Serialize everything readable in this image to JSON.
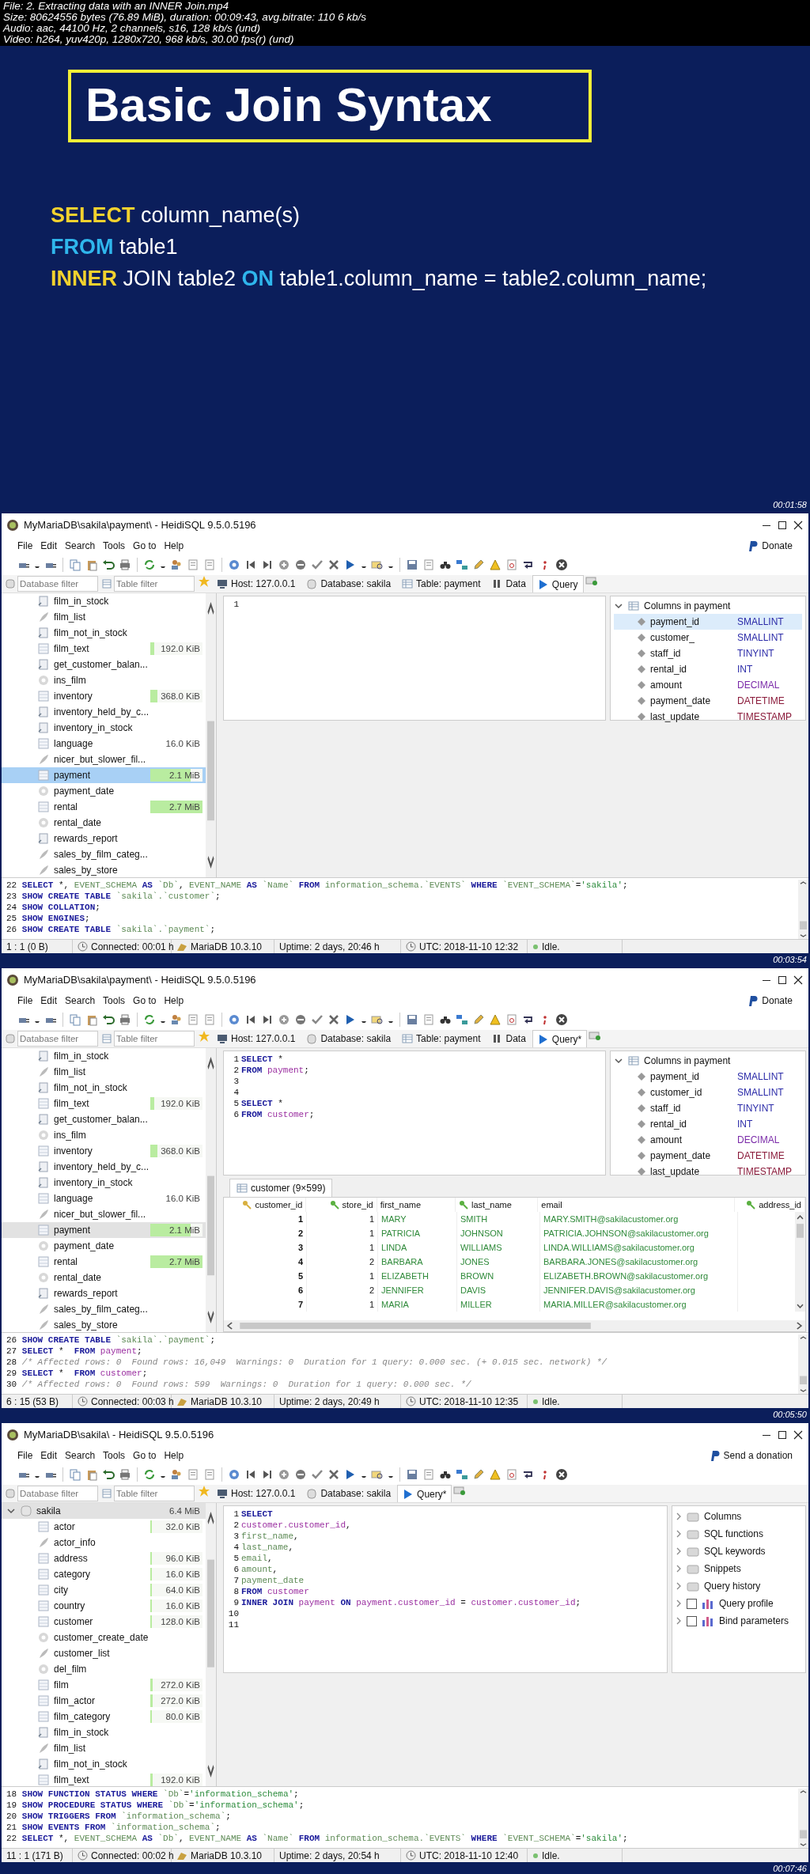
{
  "file_info": [
    "File: 2. Extracting data with an INNER Join.mp4",
    "Size: 80624556 bytes (76.89 MiB), duration: 00:09:43, avg.bitrate: 110 6 kb/s",
    "Audio: aac, 44100 Hz, 2 channels, s16, 128 kb/s (und)",
    "Video: h264, yuv420p, 1280x720, 968 kb/s, 30.00 fps(r) (und)"
  ],
  "slide": {
    "title": "Basic Join Syntax",
    "lines": [
      [
        {
          "text": "SELECT",
          "kind": "kw1"
        },
        {
          "text": " column_name(s)",
          "kind": "plain"
        }
      ],
      [
        {
          "text": "FROM",
          "kind": "kw2"
        },
        {
          "text": " table1",
          "kind": "plain"
        }
      ],
      [
        {
          "text": "INNER",
          "kind": "kw1"
        },
        {
          "text": " JOIN table2 ",
          "kind": "plain"
        },
        {
          "text": "ON",
          "kind": "kw2"
        },
        {
          "text": " table1.column_name = table2.column_name;",
          "kind": "plain"
        }
      ]
    ],
    "timestamp": "00:01:58"
  },
  "frames": [
    {
      "window_title": "MyMariaDB\\sakila\\payment\\ - HeidiSQL 9.5.0.5196",
      "menu": [
        "File",
        "Edit",
        "Search",
        "Tools",
        "Go to",
        "Help"
      ],
      "donate": "Donate",
      "filters": [
        {
          "placeholder": "Database filter"
        },
        {
          "placeholder": "Table filter"
        }
      ],
      "tabs": [
        {
          "label": "Host: 127.0.0.1",
          "kind": "host",
          "selected": false
        },
        {
          "label": "Database: sakila",
          "kind": "database",
          "selected": false
        },
        {
          "label": "Table: payment",
          "kind": "table",
          "selected": false
        },
        {
          "label": "Data",
          "kind": "data",
          "selected": false
        },
        {
          "label": "Query",
          "kind": "query",
          "selected": true
        }
      ],
      "tree_focused": true,
      "tree": [
        {
          "name": "film_in_stock",
          "kind": "procedure",
          "selected": false
        },
        {
          "name": "film_list",
          "kind": "view",
          "selected": false
        },
        {
          "name": "film_not_in_stock",
          "kind": "procedure",
          "selected": false
        },
        {
          "name": "film_text",
          "kind": "table",
          "size": "192.0 KiB",
          "level": 0.07,
          "selected": false
        },
        {
          "name": "get_customer_balan...",
          "kind": "function",
          "selected": false
        },
        {
          "name": "ins_film",
          "kind": "trigger",
          "selected": false
        },
        {
          "name": "inventory",
          "kind": "table",
          "size": "368.0 KiB",
          "level": 0.14,
          "selected": false
        },
        {
          "name": "inventory_held_by_c...",
          "kind": "function",
          "selected": false
        },
        {
          "name": "inventory_in_stock",
          "kind": "function",
          "selected": false
        },
        {
          "name": "language",
          "kind": "table",
          "size": "16.0 KiB",
          "selected": false
        },
        {
          "name": "nicer_but_slower_fil...",
          "kind": "view",
          "selected": false
        },
        {
          "name": "payment",
          "kind": "table",
          "size": "2.1 MiB",
          "level": 0.78,
          "selected": true
        },
        {
          "name": "payment_date",
          "kind": "trigger",
          "selected": false
        },
        {
          "name": "rental",
          "kind": "table",
          "size": "2.7 MiB",
          "level": 1,
          "selected": false
        },
        {
          "name": "rental_date",
          "kind": "trigger",
          "selected": false
        },
        {
          "name": "rewards_report",
          "kind": "procedure",
          "selected": false
        },
        {
          "name": "sales_by_film_categ...",
          "kind": "view",
          "selected": false
        },
        {
          "name": "sales_by_store",
          "kind": "view",
          "selected": false
        }
      ],
      "editor": [
        {
          "no": "1"
        }
      ],
      "side_panel": {
        "kind": "columns",
        "title": "Columns in payment",
        "expanded": true,
        "items": [
          {
            "name": "payment_id",
            "type": "SMALLINT",
            "color": "#2a2aa8",
            "selected": true
          },
          {
            "name": "customer_",
            "type": "SMALLINT",
            "color": "#2a2aa8",
            "selected": false
          },
          {
            "name": "staff_id",
            "type": "TINYINT",
            "color": "#2a2aa8",
            "selected": false
          },
          {
            "name": "rental_id",
            "type": "INT",
            "color": "#2a2aa8",
            "selected": false
          },
          {
            "name": "amount",
            "type": "DECIMAL",
            "color": "#7a2aa8",
            "selected": false
          },
          {
            "name": "payment_date",
            "type": "DATETIME",
            "color": "#8a1a3a",
            "selected": false
          },
          {
            "name": "last_update",
            "type": "TIMESTAMP",
            "color": "#8a1a3a",
            "selected": false
          }
        ]
      },
      "log": [
        {
          "no": "22",
          "tokens": [
            {
              "text": "SELECT",
              "kind": "kw"
            },
            {
              "text": " *, ",
              "kind": "txt"
            },
            {
              "text": "EVENT_SCHEMA",
              "kind": "col"
            },
            {
              "text": " AS",
              "kind": "kw"
            },
            {
              "text": " `Db`",
              "kind": "col"
            },
            {
              "text": ", ",
              "kind": "txt"
            },
            {
              "text": "EVENT_NAME",
              "kind": "col"
            },
            {
              "text": " AS",
              "kind": "kw"
            },
            {
              "text": " `Name`",
              "kind": "col"
            },
            {
              "text": " FROM",
              "kind": "kw"
            },
            {
              "text": " information_schema.`EVENTS`",
              "kind": "col"
            },
            {
              "text": " WHERE",
              "kind": "kw"
            },
            {
              "text": " `EVENT_SCHEMA`",
              "kind": "col"
            },
            {
              "text": "=",
              "kind": "txt"
            },
            {
              "text": "'sakila'",
              "kind": "str"
            },
            {
              "text": ";",
              "kind": "txt"
            }
          ]
        },
        {
          "no": "23",
          "tokens": [
            {
              "text": "SHOW CREATE TABLE",
              "kind": "kw"
            },
            {
              "text": " `sakila`.`customer`",
              "kind": "col"
            },
            {
              "text": ";",
              "kind": "txt"
            }
          ]
        },
        {
          "no": "24",
          "tokens": [
            {
              "text": "SHOW COLLATION",
              "kind": "kw"
            },
            {
              "text": ";",
              "kind": "txt"
            }
          ]
        },
        {
          "no": "25",
          "tokens": [
            {
              "text": "SHOW ENGINES",
              "kind": "kw"
            },
            {
              "text": ";",
              "kind": "txt"
            }
          ]
        },
        {
          "no": "26",
          "tokens": [
            {
              "text": "SHOW CREATE TABLE",
              "kind": "kw"
            },
            {
              "text": " `sakila`.`payment`",
              "kind": "col"
            },
            {
              "text": ";",
              "kind": "txt"
            }
          ]
        }
      ],
      "status": [
        {
          "text": "1 : 1 (0 B)",
          "kind": "position"
        },
        {
          "text": "Connected: 00:01 h",
          "kind": "connection"
        },
        {
          "text": "MariaDB 10.3.10",
          "kind": "server"
        },
        {
          "text": "Uptime: 2 days, 20:46 h",
          "kind": "uptime"
        },
        {
          "text": "UTC: 2018-11-10 12:32",
          "kind": "time"
        },
        {
          "text": "Idle.",
          "kind": "state"
        }
      ],
      "timestamp": "00:03:54"
    },
    {
      "window_title": "MyMariaDB\\sakila\\payment\\ - HeidiSQL 9.5.0.5196",
      "menu": [
        "File",
        "Edit",
        "Search",
        "Tools",
        "Go to",
        "Help"
      ],
      "donate": "Donate",
      "filters": [
        {
          "placeholder": "Database filter"
        },
        {
          "placeholder": "Table filter"
        }
      ],
      "tabs": [
        {
          "label": "Host: 127.0.0.1",
          "kind": "host",
          "selected": false
        },
        {
          "label": "Database: sakila",
          "kind": "database",
          "selected": false
        },
        {
          "label": "Table: payment",
          "kind": "table",
          "selected": false
        },
        {
          "label": "Data",
          "kind": "data",
          "selected": false
        },
        {
          "label": "Query*",
          "kind": "query",
          "selected": true
        }
      ],
      "tree_focused": false,
      "tree": [
        {
          "name": "film_in_stock",
          "kind": "procedure",
          "selected": false
        },
        {
          "name": "film_list",
          "kind": "view",
          "selected": false
        },
        {
          "name": "film_not_in_stock",
          "kind": "procedure",
          "selected": false
        },
        {
          "name": "film_text",
          "kind": "table",
          "size": "192.0 KiB",
          "level": 0.07,
          "selected": false
        },
        {
          "name": "get_customer_balan...",
          "kind": "function",
          "selected": false
        },
        {
          "name": "ins_film",
          "kind": "trigger",
          "selected": false
        },
        {
          "name": "inventory",
          "kind": "table",
          "size": "368.0 KiB",
          "level": 0.14,
          "selected": false
        },
        {
          "name": "inventory_held_by_c...",
          "kind": "function",
          "selected": false
        },
        {
          "name": "inventory_in_stock",
          "kind": "function",
          "selected": false
        },
        {
          "name": "language",
          "kind": "table",
          "size": "16.0 KiB",
          "selected": false
        },
        {
          "name": "nicer_but_slower_fil...",
          "kind": "view",
          "selected": false
        },
        {
          "name": "payment",
          "kind": "table",
          "size": "2.1 MiB",
          "level": 0.78,
          "selected": true
        },
        {
          "name": "payment_date",
          "kind": "trigger",
          "selected": false
        },
        {
          "name": "rental",
          "kind": "table",
          "size": "2.7 MiB",
          "level": 1,
          "selected": false
        },
        {
          "name": "rental_date",
          "kind": "trigger",
          "selected": false
        },
        {
          "name": "rewards_report",
          "kind": "procedure",
          "selected": false
        },
        {
          "name": "sales_by_film_categ...",
          "kind": "view",
          "selected": false
        },
        {
          "name": "sales_by_store",
          "kind": "view",
          "selected": false
        }
      ],
      "editor": [
        {
          "no": "1",
          "tokens": [
            {
              "text": "SELECT",
              "kind": "kw"
            },
            {
              "text": " *",
              "kind": "txt"
            }
          ]
        },
        {
          "no": "2",
          "tokens": [
            {
              "text": "FROM",
              "kind": "kw"
            },
            {
              "text": " payment",
              "kind": "tbl"
            },
            {
              "text": ";",
              "kind": "txt"
            }
          ]
        },
        {
          "no": "3"
        },
        {
          "no": "4"
        },
        {
          "no": "5",
          "tokens": [
            {
              "text": "SELECT",
              "kind": "kw"
            },
            {
              "text": " *",
              "kind": "txt"
            }
          ]
        },
        {
          "no": "6",
          "tokens": [
            {
              "text": "FROM",
              "kind": "kw"
            },
            {
              "text": " customer",
              "kind": "tbl"
            },
            {
              "text": ";",
              "kind": "txt"
            }
          ]
        }
      ],
      "side_panel": {
        "kind": "columns",
        "title": "Columns in payment",
        "expanded": true,
        "items": [
          {
            "name": "payment_id",
            "type": "SMALLINT",
            "color": "#2a2aa8",
            "selected": false
          },
          {
            "name": "customer_id",
            "type": "SMALLINT",
            "color": "#2a2aa8",
            "selected": false
          },
          {
            "name": "staff_id",
            "type": "TINYINT",
            "color": "#2a2aa8",
            "selected": false
          },
          {
            "name": "rental_id",
            "type": "INT",
            "color": "#2a2aa8",
            "selected": false
          },
          {
            "name": "amount",
            "type": "DECIMAL",
            "color": "#7a2aa8",
            "selected": false
          },
          {
            "name": "payment_date",
            "type": "DATETIME",
            "color": "#8a1a3a",
            "selected": false
          },
          {
            "name": "last_update",
            "type": "TIMESTAMP",
            "color": "#8a1a3a",
            "selected": false
          }
        ]
      },
      "result": {
        "tab": "customer (9×599)",
        "columns": [
          {
            "label": "customer_id",
            "kind": "primary"
          },
          {
            "label": "store_id",
            "kind": "foreign"
          },
          {
            "label": "first_name",
            "kind": "plain"
          },
          {
            "label": "last_name",
            "kind": "foreign"
          },
          {
            "label": "email",
            "kind": "plain"
          },
          {
            "label": "address_id",
            "kind": "foreign"
          }
        ],
        "rows": [
          [
            "1",
            "1",
            "MARY",
            "SMITH",
            "MARY.SMITH@sakilacustomer.org"
          ],
          [
            "2",
            "1",
            "PATRICIA",
            "JOHNSON",
            "PATRICIA.JOHNSON@sakilacustomer.org"
          ],
          [
            "3",
            "1",
            "LINDA",
            "WILLIAMS",
            "LINDA.WILLIAMS@sakilacustomer.org"
          ],
          [
            "4",
            "2",
            "BARBARA",
            "JONES",
            "BARBARA.JONES@sakilacustomer.org"
          ],
          [
            "5",
            "1",
            "ELIZABETH",
            "BROWN",
            "ELIZABETH.BROWN@sakilacustomer.org"
          ],
          [
            "6",
            "2",
            "JENNIFER",
            "DAVIS",
            "JENNIFER.DAVIS@sakilacustomer.org"
          ],
          [
            "7",
            "1",
            "MARIA",
            "MILLER",
            "MARIA.MILLER@sakilacustomer.org"
          ]
        ]
      },
      "log": [
        {
          "no": "26",
          "tokens": [
            {
              "text": "SHOW CREATE TABLE",
              "kind": "kw"
            },
            {
              "text": " `sakila`.`payment`",
              "kind": "col"
            },
            {
              "text": ";",
              "kind": "txt"
            }
          ]
        },
        {
          "no": "27",
          "tokens": [
            {
              "text": "SELECT",
              "kind": "kw"
            },
            {
              "text": " *  ",
              "kind": "txt"
            },
            {
              "text": "FROM",
              "kind": "kw"
            },
            {
              "text": " payment",
              "kind": "tbl"
            },
            {
              "text": ";",
              "kind": "txt"
            }
          ]
        },
        {
          "no": "28",
          "tokens": [
            {
              "text": "/* Affected rows: 0  Found rows: 16,049  Warnings: 0  Duration for 1 query: 0.000 sec. (+ 0.015 sec. network) */",
              "kind": "cmt"
            }
          ]
        },
        {
          "no": "29",
          "tokens": [
            {
              "text": "SELECT",
              "kind": "kw"
            },
            {
              "text": " *  ",
              "kind": "txt"
            },
            {
              "text": "FROM",
              "kind": "kw"
            },
            {
              "text": " customer",
              "kind": "tbl"
            },
            {
              "text": ";",
              "kind": "txt"
            }
          ]
        },
        {
          "no": "30",
          "tokens": [
            {
              "text": "/* Affected rows: 0  Found rows: 599  Warnings: 0  Duration for 1 query: 0.000 sec. */",
              "kind": "cmt"
            }
          ]
        }
      ],
      "status": [
        {
          "text": "6 : 15 (53 B)",
          "kind": "position"
        },
        {
          "text": "Connected: 00:03 h",
          "kind": "connection"
        },
        {
          "text": "MariaDB 10.3.10",
          "kind": "server"
        },
        {
          "text": "Uptime: 2 days, 20:49 h",
          "kind": "uptime"
        },
        {
          "text": "UTC: 2018-11-10 12:35",
          "kind": "time"
        },
        {
          "text": "Idle.",
          "kind": "state"
        }
      ],
      "timestamp": "00:05:50"
    },
    {
      "window_title": "MyMariaDB\\sakila\\ - HeidiSQL 9.5.0.5196",
      "menu": [
        "File",
        "Edit",
        "Search",
        "Tools",
        "Go to",
        "Help"
      ],
      "donate": "Send a donation",
      "filters": [
        {
          "placeholder": "Database filter"
        },
        {
          "placeholder": "Table filter"
        }
      ],
      "tabs": [
        {
          "label": "Host: 127.0.0.1",
          "kind": "host",
          "selected": false
        },
        {
          "label": "Database: sakila",
          "kind": "database",
          "selected": false
        },
        {
          "label": "Query*",
          "kind": "query",
          "selected": true
        }
      ],
      "tree_focused": false,
      "tree": [
        {
          "name": "sakila",
          "kind": "database",
          "size": "6.4 MiB",
          "selected": true,
          "expanded": true,
          "children": [
            {
              "name": "actor",
              "kind": "table",
              "size": "32.0 KiB",
              "level": 0.02,
              "selected": false
            },
            {
              "name": "actor_info",
              "kind": "view",
              "selected": false
            },
            {
              "name": "address",
              "kind": "table",
              "size": "96.0 KiB",
              "level": 0.03,
              "selected": false
            },
            {
              "name": "category",
              "kind": "table",
              "size": "16.0 KiB",
              "level": 0.01,
              "selected": false
            },
            {
              "name": "city",
              "kind": "table",
              "size": "64.0 KiB",
              "level": 0.02,
              "selected": false
            },
            {
              "name": "country",
              "kind": "table",
              "size": "16.0 KiB",
              "level": 0.01,
              "selected": false
            },
            {
              "name": "customer",
              "kind": "table",
              "size": "128.0 KiB",
              "level": 0.03,
              "selected": false
            },
            {
              "name": "customer_create_date",
              "kind": "trigger",
              "selected": false
            },
            {
              "name": "customer_list",
              "kind": "view",
              "selected": false
            },
            {
              "name": "del_film",
              "kind": "trigger",
              "selected": false
            },
            {
              "name": "film",
              "kind": "table",
              "size": "272.0 KiB",
              "level": 0.05,
              "selected": false
            },
            {
              "name": "film_actor",
              "kind": "table",
              "size": "272.0 KiB",
              "level": 0.05,
              "selected": false
            },
            {
              "name": "film_category",
              "kind": "table",
              "size": "80.0 KiB",
              "level": 0.02,
              "selected": false
            },
            {
              "name": "film_in_stock",
              "kind": "procedure",
              "selected": false
            },
            {
              "name": "film_list",
              "kind": "view",
              "selected": false
            },
            {
              "name": "film_not_in_stock",
              "kind": "procedure",
              "selected": false
            },
            {
              "name": "film_text",
              "kind": "table",
              "size": "192.0 KiB",
              "level": 0.04,
              "selected": false
            }
          ]
        }
      ],
      "editor": [
        {
          "no": "1",
          "tokens": [
            {
              "text": "SELECT",
              "kind": "kw"
            }
          ]
        },
        {
          "no": "2",
          "tokens": [
            {
              "text": "customer.customer_id",
              "kind": "tbl"
            },
            {
              "text": ",",
              "kind": "txt"
            }
          ]
        },
        {
          "no": "3",
          "tokens": [
            {
              "text": "first_name",
              "kind": "col"
            },
            {
              "text": ",",
              "kind": "txt"
            }
          ]
        },
        {
          "no": "4",
          "tokens": [
            {
              "text": "last_name",
              "kind": "col"
            },
            {
              "text": ",",
              "kind": "txt"
            }
          ]
        },
        {
          "no": "5",
          "tokens": [
            {
              "text": "email",
              "kind": "col"
            },
            {
              "text": ",",
              "kind": "txt"
            }
          ]
        },
        {
          "no": "6",
          "tokens": [
            {
              "text": "amount",
              "kind": "col"
            },
            {
              "text": ",",
              "kind": "txt"
            }
          ]
        },
        {
          "no": "7",
          "tokens": [
            {
              "text": "payment_date",
              "kind": "col"
            }
          ]
        },
        {
          "no": "8",
          "tokens": [
            {
              "text": "FROM",
              "kind": "kw"
            },
            {
              "text": " customer",
              "kind": "tbl"
            }
          ]
        },
        {
          "no": "9",
          "tokens": [
            {
              "text": "INNER JOIN",
              "kind": "kw"
            },
            {
              "text": " payment",
              "kind": "tbl"
            },
            {
              "text": " ON",
              "kind": "kw"
            },
            {
              "text": " payment.customer_id",
              "kind": "tbl"
            },
            {
              "text": " = ",
              "kind": "txt"
            },
            {
              "text": "customer.customer_id",
              "kind": "tbl"
            },
            {
              "text": ";",
              "kind": "txt"
            }
          ]
        },
        {
          "no": "10"
        },
        {
          "no": "11"
        }
      ],
      "side_panel": {
        "kind": "helpers",
        "items": [
          {
            "label": "Columns",
            "kind": "folder"
          },
          {
            "label": "SQL functions",
            "kind": "folder"
          },
          {
            "label": "SQL keywords",
            "kind": "folder"
          },
          {
            "label": "Snippets",
            "kind": "folder"
          },
          {
            "label": "Query history",
            "kind": "folder"
          },
          {
            "label": "Query profile",
            "kind": "checkbox",
            "checked": false
          },
          {
            "label": "Bind parameters",
            "kind": "checkbox",
            "checked": false
          }
        ]
      },
      "log": [
        {
          "no": "18",
          "tokens": [
            {
              "text": "SHOW FUNCTION STATUS WHERE",
              "kind": "kw"
            },
            {
              "text": " `Db`",
              "kind": "col"
            },
            {
              "text": "=",
              "kind": "txt"
            },
            {
              "text": "'information_schema'",
              "kind": "str"
            },
            {
              "text": ";",
              "kind": "txt"
            }
          ]
        },
        {
          "no": "19",
          "tokens": [
            {
              "text": "SHOW PROCEDURE STATUS WHERE",
              "kind": "kw"
            },
            {
              "text": " `Db`",
              "kind": "col"
            },
            {
              "text": "=",
              "kind": "txt"
            },
            {
              "text": "'information_schema'",
              "kind": "str"
            },
            {
              "text": ";",
              "kind": "txt"
            }
          ]
        },
        {
          "no": "20",
          "tokens": [
            {
              "text": "SHOW TRIGGERS FROM",
              "kind": "kw"
            },
            {
              "text": " `information_schema`",
              "kind": "col"
            },
            {
              "text": ";",
              "kind": "txt"
            }
          ]
        },
        {
          "no": "21",
          "tokens": [
            {
              "text": "SHOW EVENTS FROM",
              "kind": "kw"
            },
            {
              "text": " `information_schema`",
              "kind": "col"
            },
            {
              "text": ";",
              "kind": "txt"
            }
          ]
        },
        {
          "no": "22",
          "tokens": [
            {
              "text": "SELECT",
              "kind": "kw"
            },
            {
              "text": " *, ",
              "kind": "txt"
            },
            {
              "text": "EVENT_SCHEMA",
              "kind": "col"
            },
            {
              "text": " AS",
              "kind": "kw"
            },
            {
              "text": " `Db`",
              "kind": "col"
            },
            {
              "text": ", ",
              "kind": "txt"
            },
            {
              "text": "EVENT_NAME",
              "kind": "col"
            },
            {
              "text": " AS",
              "kind": "kw"
            },
            {
              "text": " `Name`",
              "kind": "col"
            },
            {
              "text": " FROM",
              "kind": "kw"
            },
            {
              "text": " information_schema.`EVENTS`",
              "kind": "col"
            },
            {
              "text": " WHERE",
              "kind": "kw"
            },
            {
              "text": " `EVENT_SCHEMA`",
              "kind": "col"
            },
            {
              "text": "=",
              "kind": "txt"
            },
            {
              "text": "'sakila'",
              "kind": "str"
            },
            {
              "text": ";",
              "kind": "txt"
            }
          ]
        }
      ],
      "status": [
        {
          "text": "11 : 1 (171 B)",
          "kind": "position"
        },
        {
          "text": "Connected: 00:02 h",
          "kind": "connection"
        },
        {
          "text": "MariaDB 10.3.10",
          "kind": "server"
        },
        {
          "text": "Uptime: 2 days, 20:54 h",
          "kind": "uptime"
        },
        {
          "text": "UTC: 2018-11-10 12:40",
          "kind": "time"
        },
        {
          "text": "Idle.",
          "kind": "state"
        }
      ],
      "timestamp": "00:07:46"
    }
  ]
}
